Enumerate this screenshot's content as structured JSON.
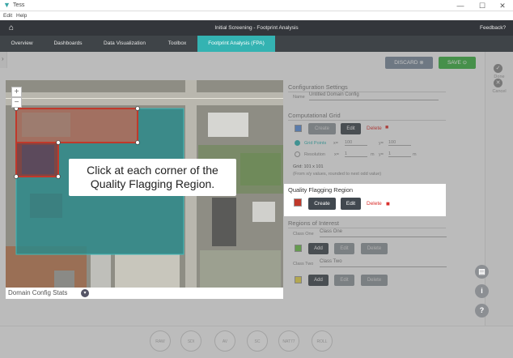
{
  "window": {
    "app_title": "Tess",
    "minimize": "—",
    "maximize": "☐",
    "close": "✕"
  },
  "menu": {
    "items": [
      "Edit",
      "Help"
    ]
  },
  "header": {
    "title": "Initial Screening - Footprint Analysis",
    "feedback": "Feedback?"
  },
  "tabs": [
    {
      "label": "Overview",
      "active": false
    },
    {
      "label": "Dashboards",
      "active": false
    },
    {
      "label": "Data Visualization",
      "active": false
    },
    {
      "label": "Toolbox",
      "active": false
    },
    {
      "label": "Footprint Analysis (FPA)",
      "active": true
    }
  ],
  "toolbar": {
    "discard_label": "DISCARD",
    "save_label": "SAVE"
  },
  "right_toolbar": {
    "done_label": "Done",
    "cancel_label": "Cancel"
  },
  "config": {
    "section_title": "Configuration Settings",
    "name_label": "Name",
    "name_value": "Untitled Domain Config",
    "comp_grid": {
      "title": "Computational Grid",
      "create": "Create",
      "edit": "Edit",
      "delete": "Delete",
      "grid_points_label": "Grid Points",
      "x_label": "x=",
      "x_value": "100",
      "y_label": "y=",
      "y_value": "100",
      "resolution_label": "Resolution",
      "res_x_value": "1",
      "res_x_unit": "m",
      "res_y_value": "1",
      "res_y_unit": "m",
      "grid_summary": "Grid: 101 x 101",
      "grid_note": "(From x/y values, rounded to next odd value)"
    },
    "qfr": {
      "title": "Quality Flagging Region",
      "create": "Create",
      "edit": "Edit",
      "delete": "Delete"
    },
    "roi": {
      "title": "Regions of Interest",
      "class_one_label": "Class One",
      "class_one_value": "Class One",
      "class_two_label": "Class Two",
      "class_two_value": "Class Two",
      "add": "Add",
      "edit": "Edit",
      "delete": "Delete"
    }
  },
  "map": {
    "zoom_in": "+",
    "zoom_out": "−",
    "tooltip_line1": "Click at each corner of the",
    "tooltip_line2": "Quality Flagging Region.",
    "footer_label": "Domain Config Stats"
  },
  "bottom_bar": {
    "items": [
      "RAW",
      "SDI",
      "AV",
      "SC",
      "NAT77",
      "ROLL"
    ]
  },
  "colors": {
    "accent": "#34b3b2",
    "save": "#3cb043",
    "discard": "#7a8a9c",
    "delete": "#d9302c",
    "qfr_swatch": "#c0392b"
  }
}
